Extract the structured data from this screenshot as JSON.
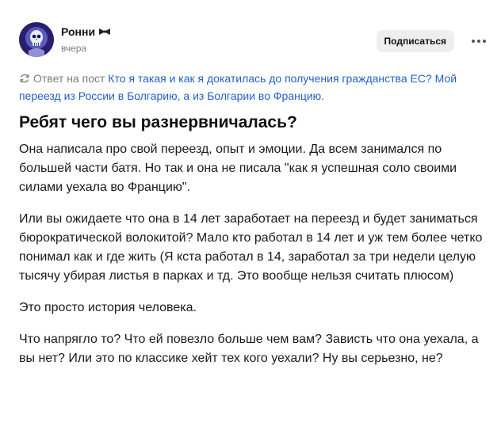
{
  "author": {
    "name": "Ронни",
    "avatar_icon": "skull-avatar-icon",
    "badge_icon": "bow-tie-icon"
  },
  "post": {
    "time": "вчера",
    "subscribe_label": "Подписаться",
    "more_icon": "more-dots-icon",
    "reply_prefix": "Ответ на пост",
    "reply_link": "Кто я такая и как я докатилась до получения гражданства ЕС? Мой переезд из России в Болгарию, а из Болгарии во Францию.",
    "title": "Ребят чего вы разнервничалась?",
    "paragraphs": [
      "Она написала про свой переезд, опыт и эмоции. Да всем занимался по большей части батя. Но так и она не писала \"как я успешная соло своими силами уехала во Францию\".",
      "Или вы ожидаете что она в 14 лет заработает на переезд и будет заниматься бюрократической волокитой? Мало кто работал в 14 лет и уж тем более четко понимал как и где жить (Я кста работал в 14, заработал за три недели целую тысячу убирая листья в парках и тд. Это вообще нельзя считать плюсом)",
      "Это просто история человека.",
      "Что напрягло то? Что ей повезло больше чем вам? Зависть что она уехала, а вы нет? Или это по классике хейт тех кого уехали? Ну вы серьезно, не?"
    ]
  },
  "colors": {
    "link": "#2260c4",
    "muted": "#7d7d7d",
    "button_bg": "#eeeeef"
  }
}
